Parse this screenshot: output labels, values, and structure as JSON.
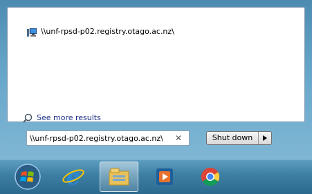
{
  "results": {
    "item_label": "\\\\unf-rpsd-p02.registry.otago.ac.nz\\",
    "item_icon": "network-computer-icon",
    "see_more_label": "See more results",
    "see_more_icon": "search-icon"
  },
  "search": {
    "value": "\\\\unf-rpsd-p02.registry.otago.ac.nz\\",
    "clear_icon": "close-icon"
  },
  "shutdown": {
    "label": "Shut down",
    "arrow_icon": "triangle-right-icon"
  },
  "taskbar": {
    "items": [
      {
        "icon": "start-orb-icon"
      },
      {
        "icon": "internet-explorer-icon"
      },
      {
        "icon": "file-explorer-icon",
        "active": true
      },
      {
        "icon": "media-player-icon"
      },
      {
        "icon": "chrome-icon"
      }
    ]
  }
}
